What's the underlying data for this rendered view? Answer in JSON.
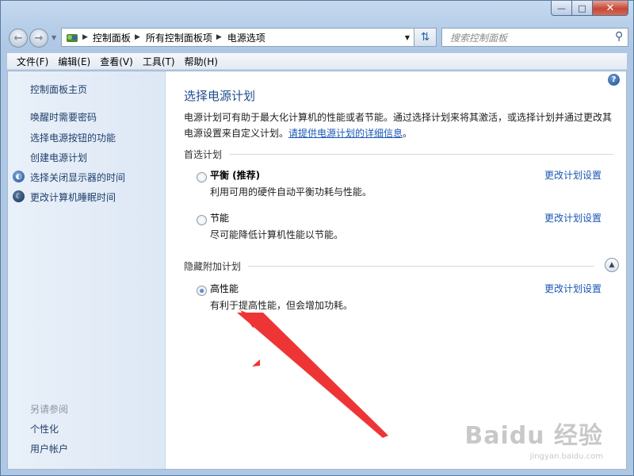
{
  "window": {
    "caption_buttons": {
      "minimize_icon": "minimize-icon",
      "maximize_icon": "maximize-icon",
      "close_icon": "close-icon"
    }
  },
  "nav": {
    "back_icon": "back-arrow-icon",
    "forward_icon": "forward-arrow-icon",
    "breadcrumb": [
      "控制面板",
      "所有控制面板项",
      "电源选项"
    ],
    "search_placeholder": "搜索控制面板"
  },
  "menubar": {
    "items": [
      "文件(F)",
      "编辑(E)",
      "查看(V)",
      "工具(T)",
      "帮助(H)"
    ]
  },
  "sidebar": {
    "home": "控制面板主页",
    "links": [
      "唤醒时需要密码",
      "选择电源按钮的功能",
      "创建电源计划",
      "选择关闭显示器的时间",
      "更改计算机睡眠时间"
    ],
    "see_also_heading": "另请参阅",
    "see_also": [
      "个性化",
      "用户帐户"
    ]
  },
  "main": {
    "title": "选择电源计划",
    "intro_text": "电源计划可有助于最大化计算机的性能或者节能。通过选择计划来将其激活，或选择计划并通过更改其电源设置来自定义计划。",
    "intro_link": "请提供电源计划的详细信息",
    "intro_end": "。",
    "preferred_label": "首选计划",
    "hidden_label": "隐藏附加计划",
    "plans": [
      {
        "name": "平衡 (推荐)",
        "desc": "利用可用的硬件自动平衡功耗与性能。",
        "selected": false
      },
      {
        "name": "节能",
        "desc": "尽可能降低计算机性能以节能。",
        "selected": false
      },
      {
        "name": "高性能",
        "desc": "有利于提高性能，但会增加功耗。",
        "selected": true
      }
    ],
    "change_link": "更改计划设置"
  },
  "annotation": {
    "color": "#ee3535"
  },
  "watermark": {
    "logo": "Baidu 经验",
    "url": "jingyan.baidu.com"
  }
}
